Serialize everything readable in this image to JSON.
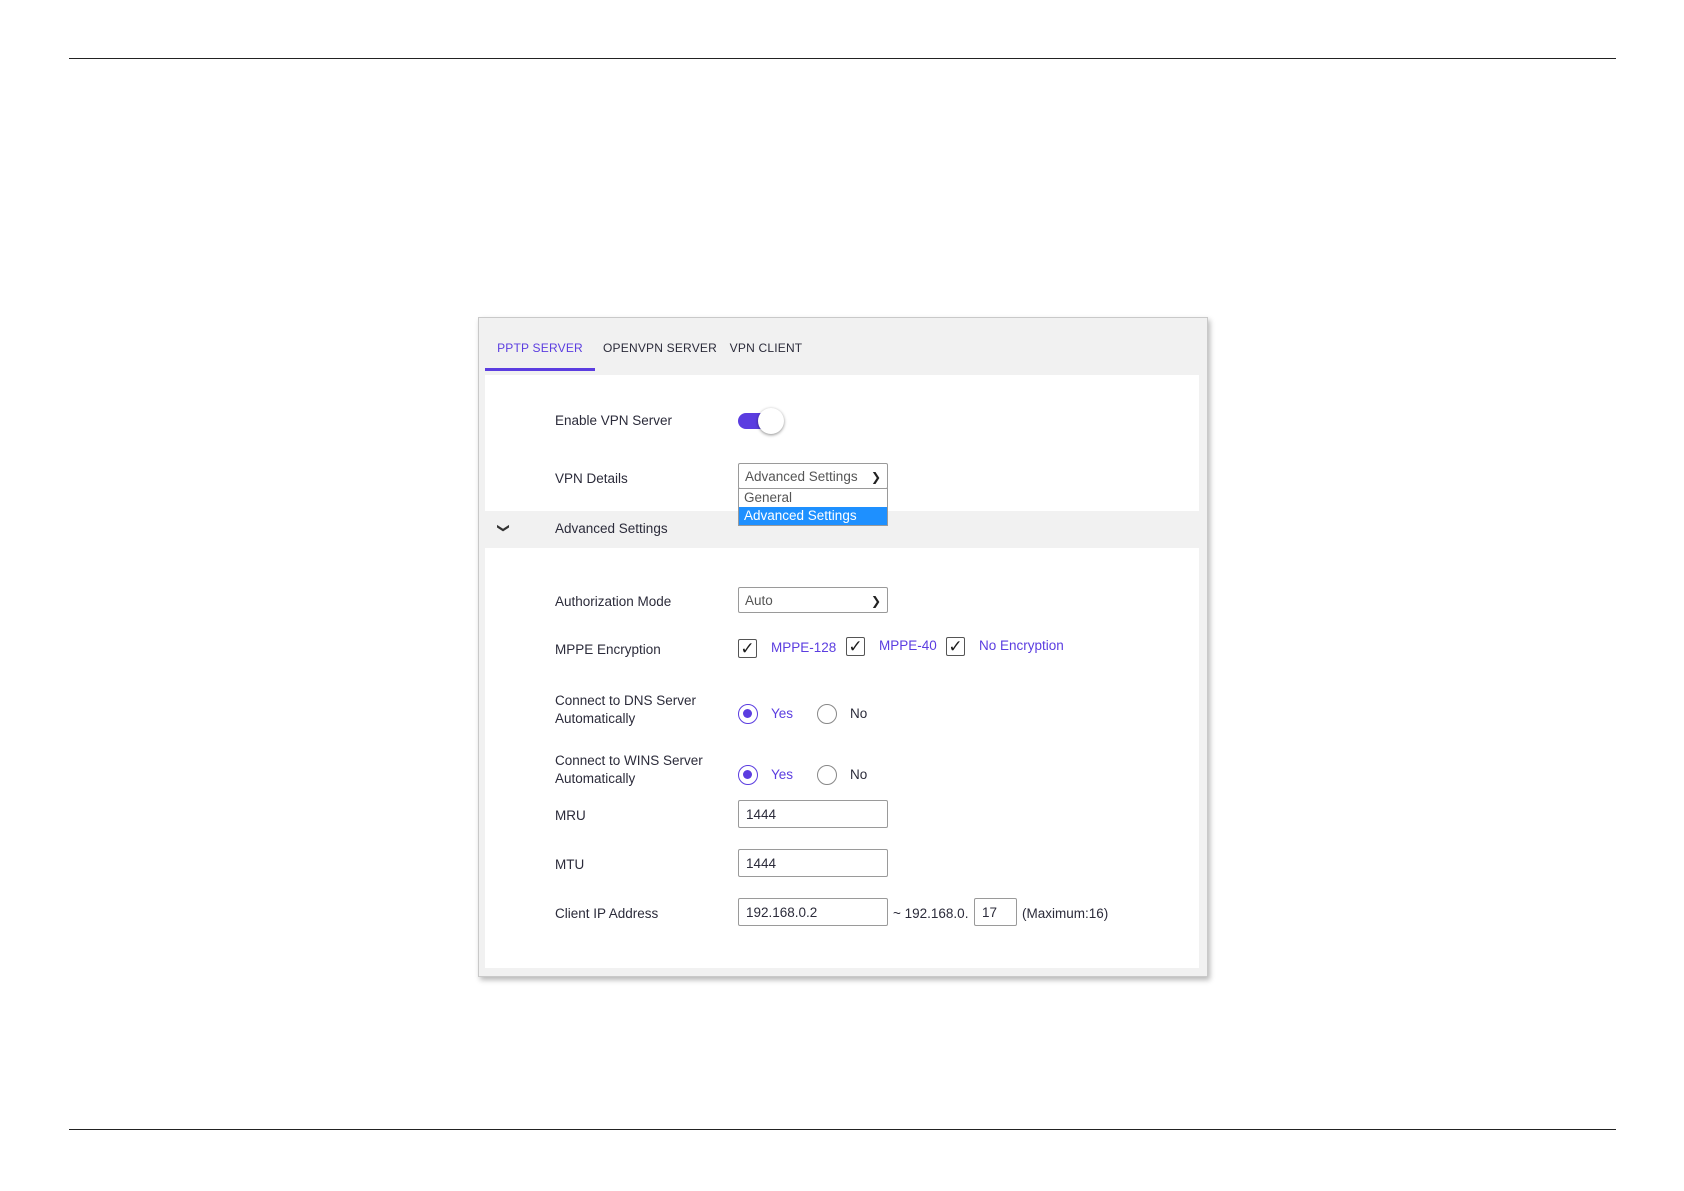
{
  "tabs": [
    {
      "label": "PPTP SERVER",
      "active": true
    },
    {
      "label": "OPENVPN SERVER",
      "active": false
    },
    {
      "label": "VPN CLIENT",
      "active": false
    }
  ],
  "accent_color": "#5b3de0",
  "enable_vpn": {
    "label": "Enable VPN Server",
    "on": true
  },
  "vpn_details": {
    "label": "VPN Details",
    "selected": "Advanced Settings",
    "options": [
      "General",
      "Advanced Settings"
    ]
  },
  "advanced_section": {
    "title": "Advanced Settings",
    "expanded": true
  },
  "auth_mode": {
    "label": "Authorization Mode",
    "selected": "Auto"
  },
  "mppe": {
    "label": "MPPE Encryption",
    "options": [
      {
        "label": "MPPE-128",
        "checked": true
      },
      {
        "label": "MPPE-40",
        "checked": true
      },
      {
        "label": "No Encryption",
        "checked": true
      }
    ]
  },
  "dns_auto": {
    "label_line1": "Connect to DNS Server",
    "label_line2": "Automatically",
    "yes": "Yes",
    "no": "No",
    "value": "Yes"
  },
  "wins_auto": {
    "label_line1": "Connect to WINS Server",
    "label_line2": "Automatically",
    "yes": "Yes",
    "no": "No",
    "value": "Yes"
  },
  "mru": {
    "label": "MRU",
    "value": "1444"
  },
  "mtu": {
    "label": "MTU",
    "value": "1444"
  },
  "client_ip": {
    "label": "Client IP Address",
    "start": "192.168.0.2",
    "separator": "~ 192.168.0.",
    "end": "17",
    "note": "(Maximum:16)"
  }
}
